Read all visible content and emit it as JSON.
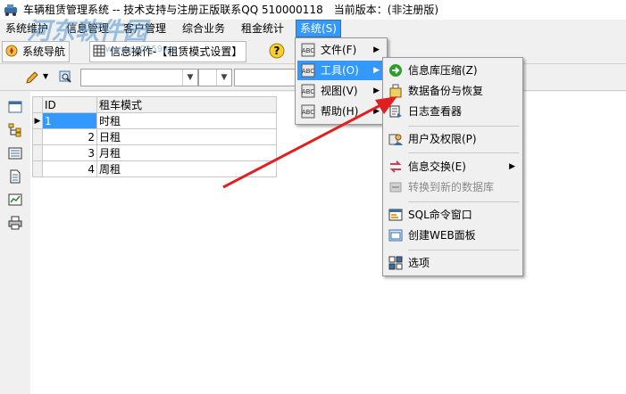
{
  "title": "车辆租赁管理系统 -- 技术支持与注册正版联系QQ 510000118　当前版本：(非注册版)",
  "menubar": [
    "系统维护",
    "信息管理",
    "客户管理",
    "综合业务",
    "租金统计",
    "系统(S)"
  ],
  "tabs": [
    "系统导航",
    "信息操作-【租赁模式设置】"
  ],
  "grid": {
    "headers": [
      "ID",
      "租车模式"
    ],
    "rows": [
      {
        "id": "1",
        "name": "时租"
      },
      {
        "id": "2",
        "name": "日租"
      },
      {
        "id": "3",
        "name": "月租"
      },
      {
        "id": "4",
        "name": "周租"
      }
    ]
  },
  "system_menu": [
    {
      "label": "文件(F)",
      "submenu": true
    },
    {
      "label": "工具(O)",
      "submenu": true,
      "selected": true
    },
    {
      "label": "视图(V)",
      "submenu": true
    },
    {
      "label": "帮助(H)",
      "submenu": true
    }
  ],
  "tools_menu": [
    {
      "label": "信息库压缩(Z)",
      "icon": "green-arrow-icon"
    },
    {
      "label": "数据备份与恢复",
      "icon": "backup-icon"
    },
    {
      "label": "日志查看器",
      "icon": "log-viewer-icon"
    },
    {
      "label": "用户及权限(P)",
      "icon": "users-icon"
    },
    {
      "label": "信息交换(E)",
      "icon": "exchange-icon",
      "submenu": true
    },
    {
      "label": "转换到新的数据库",
      "icon": "convert-db-icon",
      "disabled": true
    },
    {
      "label": "SQL命令窗口",
      "icon": "sql-window-icon"
    },
    {
      "label": "创建WEB面板",
      "icon": "web-panel-icon"
    },
    {
      "label": "选项",
      "icon": "options-icon"
    }
  ],
  "watermark": "河东软件园",
  "watermark_sub": "www.pc0359.cn",
  "colors": {
    "highlight": "#3399ff",
    "arrow": "#e02020"
  }
}
